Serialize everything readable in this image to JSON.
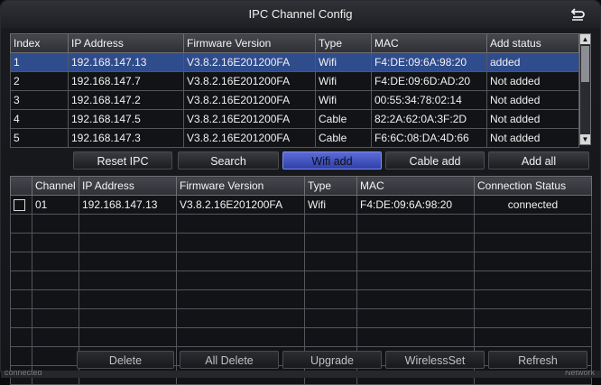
{
  "title": "IPC Channel Config",
  "search_table": {
    "headers": [
      "Index",
      "IP Address",
      "Firmware Version",
      "Type",
      "MAC",
      "Add status"
    ],
    "rows": [
      [
        "1",
        "192.168.147.13",
        "V3.8.2.16E201200FA",
        "Wifi",
        "F4:DE:09:6A:98:20",
        "added"
      ],
      [
        "2",
        "192.168.147.7",
        "V3.8.2.16E201200FA",
        "Wifi",
        "F4:DE:09:6D:AD:20",
        "Not added"
      ],
      [
        "3",
        "192.168.147.2",
        "V3.8.2.16E201200FA",
        "Wifi",
        "00:55:34:78:02:14",
        "Not added"
      ],
      [
        "4",
        "192.168.147.5",
        "V3.8.2.16E201200FA",
        "Cable",
        "82:2A:62:0A:3F:2D",
        "Not added"
      ],
      [
        "5",
        "192.168.147.3",
        "V3.8.2.16E201200FA",
        "Cable",
        "F6:6C:08:DA:4D:66",
        "Not added"
      ]
    ],
    "selected_row": 0
  },
  "buttons_top": {
    "reset": "Reset IPC",
    "search": "Search",
    "wifi_add": "Wifi add",
    "cable_add": "Cable add",
    "add_all": "Add all"
  },
  "channel_table": {
    "headers": [
      "Channel",
      "IP Address",
      "Firmware Version",
      "Type",
      "MAC",
      "Connection Status"
    ],
    "rows": [
      [
        "01",
        "192.168.147.13",
        "V3.8.2.16E201200FA",
        "Wifi",
        "F4:DE:09:6A:98:20",
        "connected"
      ]
    ],
    "empty_rows": 9
  },
  "buttons_bottom": {
    "delete": "Delete",
    "all_delete": "All Delete",
    "upgrade": "Upgrade",
    "wireless_set": "WirelessSet",
    "refresh": "Refresh"
  },
  "status": {
    "left": "connected",
    "right": "Network"
  },
  "colors": {
    "selected_row": "#2f4c8c",
    "active_button": "#4a5bd0"
  }
}
